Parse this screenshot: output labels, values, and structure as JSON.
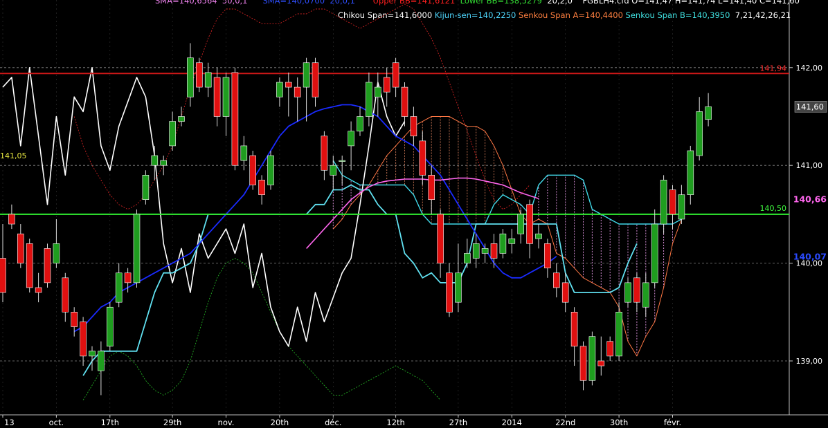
{
  "header": {
    "line1": [
      {
        "text": "SMA=140,6564",
        "color": "#ee82ee"
      },
      {
        "text": "50,0,1",
        "color": "#ee82ee"
      },
      {
        "text": "SMA=140,0700",
        "color": "#2f4fff"
      },
      {
        "text": "20,0,1",
        "color": "#2f4fff"
      },
      {
        "text": "Upper BB=141,6121",
        "color": "#ff2020"
      },
      {
        "text": "Lower BB=138,5279",
        "color": "#33dd33"
      },
      {
        "text": "20,2,0",
        "color": "#ffffff"
      },
      {
        "text": "FGBLH4.cfd O=141,47 H=141,74 L=141,40 C=141,60",
        "color": "#ffffff"
      }
    ],
    "line2": [
      {
        "text": "Chikou Span=141,6000",
        "color": "#ffffff"
      },
      {
        "text": "Kijun-sen=140,2250",
        "color": "#4fd8ff"
      },
      {
        "text": "Senkou Span A=140,4400",
        "color": "#ff8040"
      },
      {
        "text": "Senkou Span B=140,3950",
        "color": "#40e0e0"
      },
      {
        "text": "7,21,42,26,21",
        "color": "#ffffff"
      }
    ]
  },
  "colors": {
    "background": "#000000",
    "bull": "#1f9d1f",
    "bear": "#e01010",
    "chikou": "#ffffff",
    "sma50": "#ff66ee",
    "sma20": "#1a2bff",
    "kijun": "#60e0f0",
    "senkou_a": "#ff7744",
    "senkou_b": "#40d8e8",
    "upper_bb": "#cc2222",
    "lower_bb": "#22aa22",
    "resistance": "#d01818",
    "support": "#30ee30",
    "grid": "#888888"
  },
  "chart_data": {
    "type": "candlestick",
    "ylim": [
      138.5,
      142.2
    ],
    "x_count": 84,
    "y_ticks": [
      {
        "value": 142.0,
        "label": "142,00"
      },
      {
        "value": 141.0,
        "label": "141,00"
      },
      {
        "value": 140.0,
        "label": "140,00"
      },
      {
        "value": 139.0,
        "label": "139,00"
      }
    ],
    "x_ticks": [
      {
        "i": 0,
        "label": "13"
      },
      {
        "i": 6,
        "label": "oct."
      },
      {
        "i": 12,
        "label": "17th"
      },
      {
        "i": 19,
        "label": "29th"
      },
      {
        "i": 25,
        "label": "nov."
      },
      {
        "i": 31,
        "label": "20th"
      },
      {
        "i": 37,
        "label": "déc."
      },
      {
        "i": 44,
        "label": "12th"
      },
      {
        "i": 51,
        "label": "27th"
      },
      {
        "i": 57,
        "label": "2014"
      },
      {
        "i": 63,
        "label": "22nd"
      },
      {
        "i": 69,
        "label": "30th"
      },
      {
        "i": 75,
        "label": "févr."
      }
    ],
    "horizontal_lines": [
      {
        "value": 141.94,
        "label": "141,94",
        "kind": "resistance"
      },
      {
        "value": 140.5,
        "label": "140,50",
        "kind": "support"
      },
      {
        "value": 141.05,
        "label": "141,05",
        "kind": "dotted-left"
      }
    ],
    "price_labels": [
      {
        "value": 141.6,
        "label": "141,60",
        "kind": "last"
      },
      {
        "value": 140.66,
        "label": "140,66",
        "kind": "sma50"
      },
      {
        "value": 140.07,
        "label": "140,07",
        "kind": "sma20"
      }
    ],
    "candles": [
      [
        140.05,
        139.7,
        140.4,
        139.6
      ],
      [
        140.5,
        140.4,
        140.6,
        140.35
      ],
      [
        140.3,
        140.0,
        140.4,
        139.95
      ],
      [
        140.2,
        139.75,
        140.25,
        139.7
      ],
      [
        139.75,
        139.7,
        139.9,
        139.6
      ],
      [
        140.15,
        139.8,
        140.2,
        139.75
      ],
      [
        140.0,
        140.2,
        140.45,
        139.95
      ],
      [
        139.85,
        139.5,
        139.9,
        139.4
      ],
      [
        139.5,
        139.35,
        139.55,
        139.25
      ],
      [
        139.4,
        139.05,
        139.45,
        138.95
      ],
      [
        139.05,
        139.1,
        139.15,
        138.9
      ],
      [
        138.9,
        139.1,
        139.2,
        138.65
      ],
      [
        139.15,
        139.55,
        139.6,
        139.1
      ],
      [
        139.6,
        139.9,
        140.0,
        139.55
      ],
      [
        139.9,
        139.8,
        139.95,
        139.7
      ],
      [
        139.8,
        140.5,
        140.55,
        139.75
      ],
      [
        140.65,
        140.9,
        140.95,
        140.6
      ],
      [
        141.0,
        141.1,
        141.2,
        140.85
      ],
      [
        141.0,
        141.05,
        141.1,
        140.9
      ],
      [
        141.2,
        141.45,
        141.55,
        141.15
      ],
      [
        141.45,
        141.5,
        141.6,
        141.4
      ],
      [
        141.7,
        142.1,
        142.25,
        141.6
      ],
      [
        142.05,
        141.8,
        142.1,
        141.75
      ],
      [
        141.8,
        141.95,
        142.05,
        141.7
      ],
      [
        141.9,
        141.5,
        142.0,
        141.4
      ],
      [
        141.5,
        141.9,
        141.95,
        141.3
      ],
      [
        141.95,
        141.0,
        142.0,
        140.95
      ],
      [
        141.05,
        141.2,
        141.3,
        140.95
      ],
      [
        141.1,
        140.8,
        141.15,
        140.75
      ],
      [
        140.85,
        140.7,
        140.9,
        140.6
      ],
      [
        140.8,
        141.1,
        141.15,
        140.75
      ],
      [
        141.7,
        141.85,
        141.9,
        141.6
      ],
      [
        141.85,
        141.8,
        141.95,
        141.5
      ],
      [
        141.8,
        141.7,
        141.9,
        141.45
      ],
      [
        141.8,
        142.05,
        142.1,
        141.45
      ],
      [
        142.05,
        141.7,
        142.1,
        141.6
      ],
      [
        141.3,
        140.95,
        141.35,
        140.85
      ],
      [
        140.9,
        141.0,
        141.1,
        140.75
      ],
      [
        141.05,
        141.05,
        141.1,
        140.8
      ],
      [
        141.2,
        141.35,
        141.45,
        140.95
      ],
      [
        141.35,
        141.5,
        141.6,
        141.3
      ],
      [
        141.5,
        141.85,
        141.95,
        141.4
      ],
      [
        141.7,
        141.8,
        141.95,
        141.5
      ],
      [
        141.9,
        141.75,
        142.0,
        141.6
      ],
      [
        142.05,
        141.8,
        142.1,
        141.7
      ],
      [
        141.8,
        141.5,
        141.85,
        141.4
      ],
      [
        141.5,
        141.3,
        141.6,
        141.2
      ],
      [
        141.25,
        140.9,
        141.35,
        140.8
      ],
      [
        140.9,
        140.65,
        141.0,
        140.5
      ],
      [
        140.5,
        140.0,
        140.55,
        139.85
      ],
      [
        139.9,
        139.5,
        140.0,
        139.45
      ],
      [
        139.6,
        139.9,
        140.2,
        139.5
      ],
      [
        140.0,
        140.1,
        140.25,
        139.95
      ],
      [
        140.05,
        140.2,
        140.3,
        139.95
      ],
      [
        140.1,
        140.15,
        140.2,
        140.0
      ],
      [
        140.2,
        140.05,
        140.3,
        139.95
      ],
      [
        140.1,
        140.3,
        140.35,
        140.05
      ],
      [
        140.2,
        140.25,
        140.35,
        140.1
      ],
      [
        140.3,
        140.5,
        140.55,
        140.2
      ],
      [
        140.6,
        140.2,
        140.65,
        140.05
      ],
      [
        140.25,
        140.3,
        140.4,
        140.15
      ],
      [
        140.2,
        139.95,
        140.25,
        139.85
      ],
      [
        139.9,
        139.75,
        140.0,
        139.65
      ],
      [
        139.8,
        139.6,
        139.9,
        139.5
      ],
      [
        139.5,
        139.15,
        139.55,
        138.95
      ],
      [
        139.15,
        138.8,
        139.2,
        138.7
      ],
      [
        138.8,
        139.25,
        139.3,
        138.75
      ],
      [
        139.0,
        138.95,
        139.25,
        138.85
      ],
      [
        139.2,
        139.05,
        139.25,
        139.0
      ],
      [
        139.05,
        139.5,
        139.6,
        139.0
      ],
      [
        139.6,
        139.8,
        139.85,
        139.55
      ],
      [
        139.85,
        139.6,
        139.9,
        139.5
      ],
      [
        139.55,
        139.8,
        139.9,
        139.45
      ],
      [
        139.8,
        140.4,
        140.55,
        139.75
      ],
      [
        140.4,
        140.85,
        140.9,
        140.3
      ],
      [
        140.75,
        140.5,
        140.8,
        140.35
      ],
      [
        140.45,
        140.7,
        140.8,
        140.4
      ],
      [
        140.7,
        141.15,
        141.2,
        140.6
      ],
      [
        141.1,
        141.55,
        141.7,
        141.05
      ],
      [
        141.47,
        141.6,
        141.74,
        141.4
      ]
    ],
    "chikou": [
      141.8,
      141.9,
      141.2,
      142.0,
      141.3,
      140.6,
      141.5,
      140.9,
      141.7,
      141.55,
      142.0,
      141.2,
      140.95,
      141.4,
      141.65,
      141.9,
      141.7,
      141.1,
      140.2,
      139.8,
      140.15,
      139.7,
      140.3,
      140.05,
      140.2,
      140.35,
      140.1,
      140.4,
      139.75,
      140.1,
      139.55,
      139.3,
      139.15,
      139.55,
      139.2,
      139.7,
      139.4,
      139.65,
      139.9,
      140.05,
      140.6,
      141.2,
      141.85,
      141.5,
      141.3,
      141.45
    ],
    "sma20": [
      139.3,
      139.35,
      139.45,
      139.55,
      139.6,
      139.7,
      139.75,
      139.8,
      139.85,
      139.9,
      139.95,
      140.0,
      140.05,
      140.1,
      140.2,
      140.3,
      140.4,
      140.5,
      140.6,
      140.7,
      140.85,
      141.0,
      141.15,
      141.3,
      141.4,
      141.45,
      141.5,
      141.55,
      141.58,
      141.6,
      141.62,
      141.62,
      141.6,
      141.55,
      141.5,
      141.4,
      141.3,
      141.25,
      141.2,
      141.1,
      141.0,
      140.9,
      140.75,
      140.6,
      140.45,
      140.3,
      140.15,
      140.0,
      139.9,
      139.85,
      139.85,
      139.9,
      139.95,
      140.0,
      140.07
    ],
    "sma50": [
      140.15,
      140.25,
      140.35,
      140.45,
      140.55,
      140.65,
      140.72,
      140.78,
      140.82,
      140.84,
      140.85,
      140.86,
      140.86,
      140.86,
      140.85,
      140.85,
      140.86,
      140.87,
      140.87,
      140.86,
      140.84,
      140.82,
      140.8,
      140.76,
      140.72,
      140.69,
      140.66
    ],
    "kijun": [
      138.85,
      139.0,
      139.1,
      139.1,
      139.1,
      139.1,
      139.1,
      139.4,
      139.7,
      139.9,
      139.9,
      139.95,
      140.0,
      140.2,
      140.5,
      140.5,
      140.5,
      140.5,
      140.5,
      140.5,
      140.5,
      140.5,
      140.5,
      140.5,
      140.5,
      140.5,
      140.6,
      140.6,
      140.75,
      140.75,
      140.8,
      140.75,
      140.75,
      140.6,
      140.5,
      140.5,
      140.1,
      140.0,
      139.85,
      139.9,
      139.8,
      139.8,
      139.8,
      140.0,
      140.4,
      140.4,
      140.4,
      140.4,
      140.4,
      140.4,
      140.4,
      140.4,
      140.4,
      140.4,
      139.9,
      139.7,
      139.7,
      139.7,
      139.7,
      139.7,
      139.75,
      140.0,
      140.2
    ],
    "cloud_x0": 37,
    "senkou_a": [
      140.35,
      140.45,
      140.6,
      140.7,
      140.8,
      140.95,
      141.1,
      141.2,
      141.3,
      141.4,
      141.45,
      141.5,
      141.5,
      141.5,
      141.45,
      141.4,
      141.4,
      141.35,
      141.2,
      141.0,
      140.75,
      140.5,
      140.4,
      140.45,
      140.4,
      140.1,
      140.05,
      139.95,
      139.85,
      139.8,
      139.75,
      139.7,
      139.55,
      139.2,
      139.05,
      139.25,
      139.4,
      139.75,
      140.2,
      140.45
    ],
    "senkou_b": [
      141.05,
      140.9,
      140.85,
      140.8,
      140.8,
      140.8,
      140.8,
      140.8,
      140.8,
      140.7,
      140.5,
      140.4,
      140.4,
      140.4,
      140.4,
      140.4,
      140.4,
      140.4,
      140.6,
      140.7,
      140.65,
      140.6,
      140.5,
      140.8,
      140.9,
      140.9,
      140.9,
      140.9,
      140.85,
      140.55,
      140.5,
      140.45,
      140.4,
      140.4,
      140.4,
      140.4,
      140.4,
      140.4,
      140.4,
      140.45
    ],
    "upper_bb": [
      141.5,
      141.2,
      141.0,
      140.85,
      140.7,
      140.6,
      140.55,
      140.6,
      140.7,
      140.85,
      141.0,
      141.2,
      141.5,
      141.8,
      142.05,
      142.3,
      142.5,
      142.6,
      142.6,
      142.55,
      142.5,
      142.45,
      142.45,
      142.45,
      142.5,
      142.55,
      142.55,
      142.6,
      142.6,
      142.55,
      142.5,
      142.45,
      142.4,
      142.45,
      142.5,
      142.55,
      142.6,
      142.65,
      142.6,
      142.45,
      142.3,
      142.1,
      141.85,
      141.6,
      141.35,
      141.1,
      140.85,
      140.65,
      140.55,
      140.6,
      140.7,
      140.8
    ],
    "lower_bb": [
      138.6,
      138.75,
      138.9,
      139.05,
      139.1,
      139.05,
      138.95,
      138.8,
      138.7,
      138.65,
      138.7,
      138.8,
      139.0,
      139.3,
      139.6,
      139.85,
      140.0,
      140.05,
      140.0,
      139.9,
      139.7,
      139.5,
      139.3,
      139.15,
      139.05,
      138.95,
      138.85,
      138.75,
      138.65,
      138.65,
      138.7,
      138.75,
      138.8,
      138.85,
      138.9,
      138.95,
      138.9,
      138.85,
      138.8,
      138.7,
      138.6
    ]
  }
}
